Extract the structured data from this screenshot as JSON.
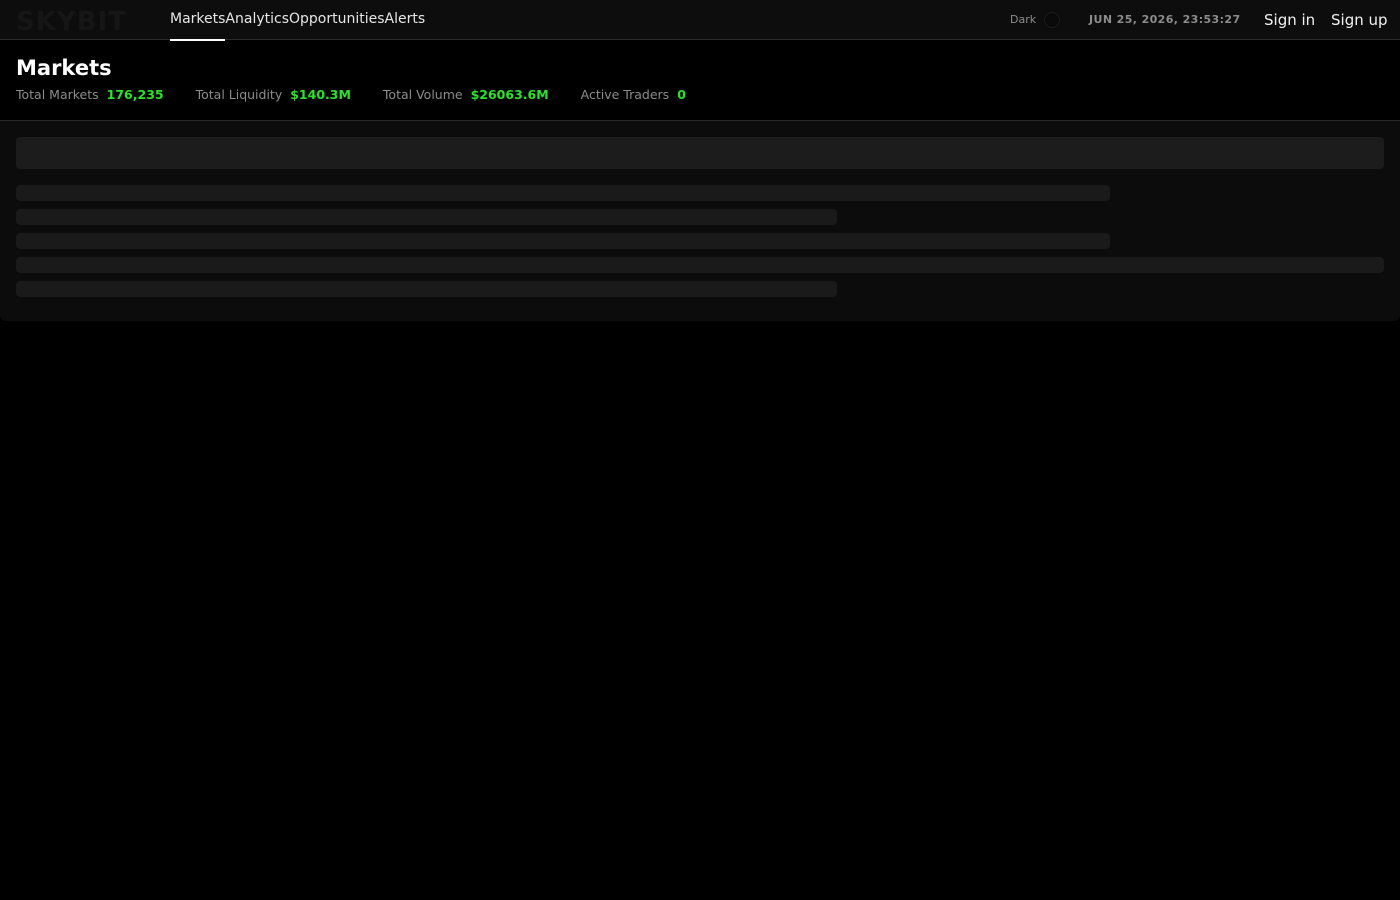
{
  "brand": {
    "logo_text": "SKYBIT"
  },
  "nav": {
    "tabs": [
      {
        "label": "Markets",
        "active": true
      },
      {
        "label": "Analytics",
        "active": false
      },
      {
        "label": "Opportunities",
        "active": false
      },
      {
        "label": "Alerts",
        "active": false
      }
    ]
  },
  "header": {
    "theme_label": "Dark",
    "clock": "JUN 25, 2026, 23:53:27",
    "sign_in": "Sign in",
    "sign_up": "Sign up"
  },
  "page": {
    "title": "Markets",
    "stats": [
      {
        "label": "Total Markets",
        "value": "176,235"
      },
      {
        "label": "Total Liquidity",
        "value": "$140.3M"
      },
      {
        "label": "Total Volume",
        "value": "$26063.6M"
      },
      {
        "label": "Active Traders",
        "value": "0"
      }
    ]
  },
  "colors": {
    "accent_green": "#26e626",
    "background": "#000000",
    "muted_text": "#8c8c8c"
  }
}
